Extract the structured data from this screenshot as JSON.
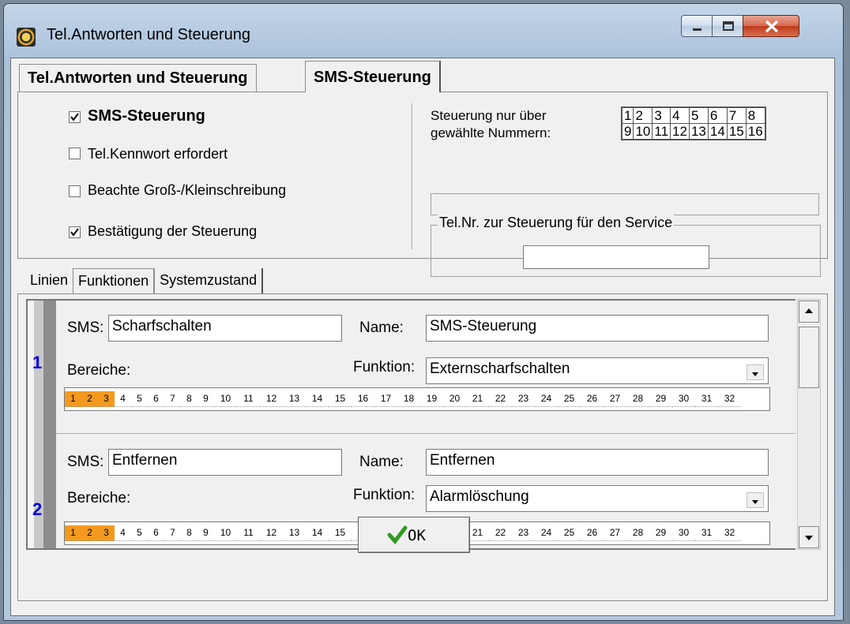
{
  "window": {
    "title": "Tel.Antworten und Steuerung"
  },
  "tabs": [
    {
      "label": "Tel.Antworten und Steuerung"
    },
    {
      "label": "SMS-Steuerung"
    }
  ],
  "sms": {
    "options": [
      {
        "label": "SMS-Steuerung",
        "checked": true
      },
      {
        "label": "Tel.Kennwort erfordert",
        "checked": false
      },
      {
        "label": "Beachte Groß-/Kleinschreibung",
        "checked": false
      },
      {
        "label": "Bestätigung der Steuerung",
        "checked": true
      }
    ],
    "numbers_label_1": "Steuerung nur über",
    "numbers_label_2": "gewählte Nummern:",
    "numbers_row1": [
      "1",
      "2",
      "3",
      "4",
      "5",
      "6",
      "7",
      "8"
    ],
    "numbers_row2": [
      "9",
      "10",
      "11",
      "12",
      "13",
      "14",
      "15",
      "16"
    ],
    "service_group_label": "Tel.Nr. zur Steuerung für den Service",
    "service_value": ""
  },
  "subtabs": [
    {
      "label": "Linien"
    },
    {
      "label": "Funktionen"
    },
    {
      "label": "Systemzustand"
    }
  ],
  "labels": {
    "sms": "SMS:",
    "name": "Name:",
    "bereiche": "Bereiche:",
    "funktion": "Funktion:"
  },
  "entries": [
    {
      "index": "1",
      "sms": "Scharfschalten",
      "name": "SMS-Steuerung",
      "funktion": "Externscharfschalten",
      "active_areas": [
        1,
        2,
        3
      ]
    },
    {
      "index": "2",
      "sms": "Entfernen",
      "name": "Entfernen",
      "funktion": "Alarmlöschung",
      "active_areas": [
        1,
        2,
        3
      ]
    }
  ],
  "areas": [
    "1",
    "2",
    "3",
    "4",
    "5",
    "6",
    "7",
    "8",
    "9",
    "10",
    "11",
    "12",
    "13",
    "14",
    "15",
    "16",
    "17",
    "18",
    "19",
    "20",
    "21",
    "22",
    "23",
    "24",
    "25",
    "26",
    "27",
    "28",
    "29",
    "30",
    "31",
    "32"
  ],
  "ok_button": {
    "label": "OK"
  },
  "colors": {
    "area_active": "#f39a1e",
    "index_number": "#0000dd"
  }
}
